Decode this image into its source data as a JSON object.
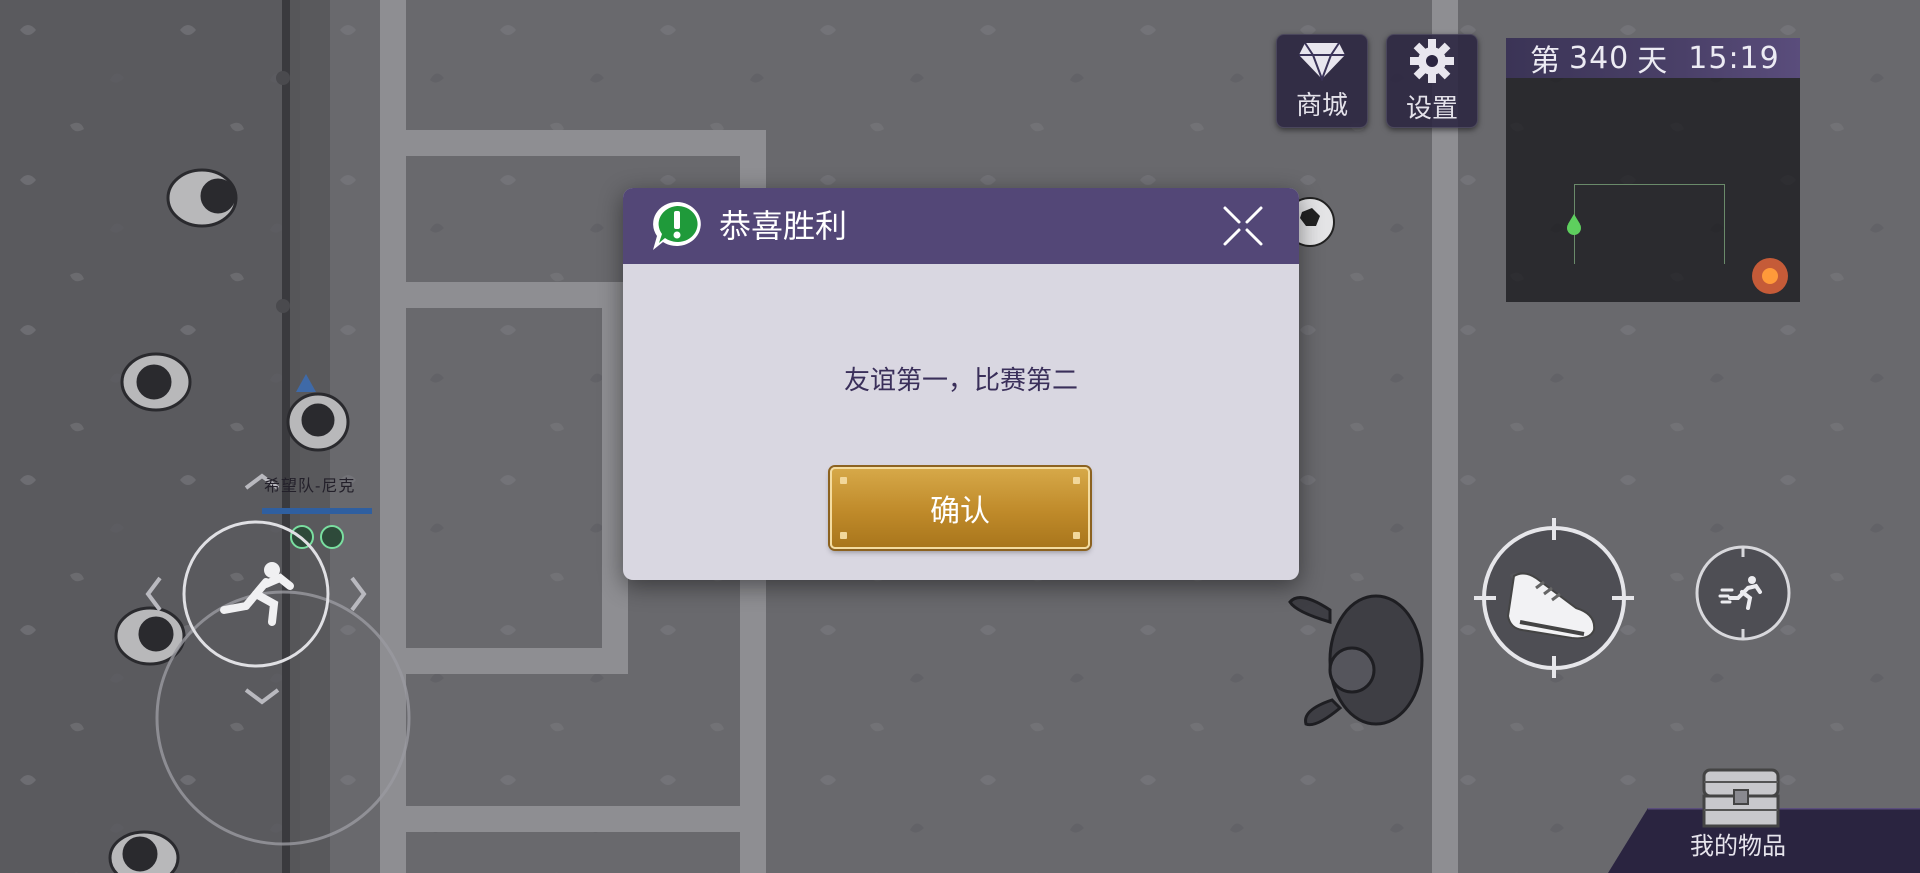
{
  "hud": {
    "shop_label": "商城",
    "settings_label": "设置",
    "day_prefix": "第",
    "day_number": "340",
    "day_suffix": "天",
    "clock": "15:19"
  },
  "dialog": {
    "title": "恭喜胜利",
    "message": "友谊第一，比赛第二",
    "confirm_label": "确认"
  },
  "player": {
    "name": "希望队-尼克"
  },
  "inventory": {
    "label": "我的物品"
  },
  "colors": {
    "dialog_header": "#534777",
    "dialog_body": "#d9d7e1",
    "confirm_gold": "#c0902e",
    "hud_panel": "#2a2440"
  },
  "icons": {
    "shop": "diamond-icon",
    "settings": "gear-icon",
    "alert": "exclamation-bubble-icon",
    "close": "close-icon",
    "kick": "shoe-icon",
    "sprint": "running-man-icon",
    "inventory": "chest-icon"
  }
}
